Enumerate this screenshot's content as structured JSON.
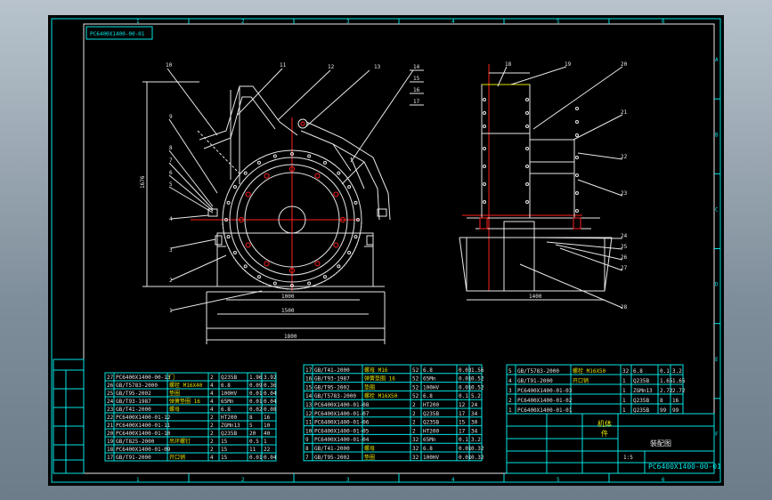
{
  "drawing": {
    "code_top": "PC6400X1400-00-01",
    "code_bottom": "PC6400X1400-00-01",
    "title_text": "装配图",
    "scale": "1:5",
    "border_numbers": [
      "1",
      "2",
      "3",
      "4",
      "5",
      "6"
    ],
    "border_letters": [
      "A",
      "B",
      "C",
      "D",
      "E",
      "F"
    ]
  },
  "front_view": {
    "balloons": [
      "10",
      "11",
      "12",
      "13",
      "14",
      "15",
      "16",
      "17",
      "9",
      "8",
      "7",
      "6",
      "5",
      "4",
      "3",
      "2",
      "1"
    ],
    "dims": [
      "1000",
      "1500",
      "1800",
      "1676"
    ]
  },
  "side_view": {
    "balloons": [
      "18",
      "19",
      "20",
      "21",
      "22",
      "23",
      "24",
      "25",
      "26",
      "27",
      "28"
    ],
    "dims": [
      "1400"
    ]
  },
  "bom_left": [
    {
      "no": "27",
      "code": "PC6400X1400-00-13",
      "name": "门",
      "qty": "2",
      "mat": "Q235B",
      "w": "1.96",
      "tw": "3.92"
    },
    {
      "no": "26",
      "code": "GB/T5783-2000",
      "name": "螺栓 M16X40",
      "qty": "4",
      "mat": "6.8",
      "w": "0.09",
      "tw": "0.36"
    },
    {
      "no": "25",
      "code": "GB/T95-2002",
      "name": "垫圈",
      "qty": "4",
      "mat": "100HV",
      "w": "0.01",
      "tw": "0.04"
    },
    {
      "no": "24",
      "code": "GB/T93-1987",
      "name": "弹簧垫圈 16",
      "qty": "4",
      "mat": "65Mn",
      "w": "0.01",
      "tw": "0.04"
    },
    {
      "no": "23",
      "code": "GB/T41-2000",
      "name": "螺母",
      "qty": "4",
      "mat": "6.8",
      "w": "0.02",
      "tw": "0.08"
    },
    {
      "no": "22",
      "code": "PC6400X1400-01-12",
      "name": "",
      "qty": "2",
      "mat": "HT200",
      "w": "8",
      "tw": "16"
    },
    {
      "no": "21",
      "code": "PC6400X1400-01-11",
      "name": "",
      "qty": "2",
      "mat": "ZGMn13",
      "w": "5",
      "tw": "10"
    },
    {
      "no": "20",
      "code": "PC6400X1400-01-10",
      "name": "",
      "qty": "2",
      "mat": "Q235B",
      "w": "20",
      "tw": "40"
    },
    {
      "no": "19",
      "code": "GB/T825-2000",
      "name": "吊环螺钉",
      "qty": "2",
      "mat": "15",
      "w": "0.5",
      "tw": "1"
    },
    {
      "no": "18",
      "code": "PC6400X1400-01-09",
      "name": "",
      "qty": "2",
      "mat": "15",
      "w": "11",
      "tw": "22"
    },
    {
      "no": "17",
      "code": "GB/T91-2000",
      "name": "开口销",
      "qty": "4",
      "mat": "15",
      "w": "0.01",
      "tw": "0.04"
    }
  ],
  "bom_mid": [
    {
      "no": "17",
      "code": "GB/T41-2000",
      "name": "螺母 M16",
      "qty": "52",
      "mat": "6.8",
      "w": "0.03",
      "tw": "1.56"
    },
    {
      "no": "16",
      "code": "GB/T93-1987",
      "name": "弹簧垫圈 16",
      "qty": "52",
      "mat": "65Mn",
      "w": "0.01",
      "tw": "0.52"
    },
    {
      "no": "15",
      "code": "GB/T95-2002",
      "name": "垫圈",
      "qty": "52",
      "mat": "100HV",
      "w": "0.01",
      "tw": "0.52"
    },
    {
      "no": "14",
      "code": "GB/T5783-2000",
      "name": "螺栓 M16X50",
      "qty": "52",
      "mat": "6.8",
      "w": "0.1",
      "tw": "5.2"
    },
    {
      "no": "13",
      "code": "PC6400X1400-01-08",
      "name": "",
      "qty": "2",
      "mat": "HT200",
      "w": "12",
      "tw": "24"
    },
    {
      "no": "12",
      "code": "PC6400X1400-01-07",
      "name": "",
      "qty": "2",
      "mat": "Q235B",
      "w": "17",
      "tw": "34"
    },
    {
      "no": "11",
      "code": "PC6400X1400-01-06",
      "name": "",
      "qty": "2",
      "mat": "Q235B",
      "w": "15",
      "tw": "30"
    },
    {
      "no": "10",
      "code": "PC6400X1400-01-05",
      "name": "",
      "qty": "2",
      "mat": "HT200",
      "w": "17",
      "tw": "34"
    },
    {
      "no": "9",
      "code": "PC6400X1400-01-04",
      "name": "",
      "qty": "32",
      "mat": "65Mn",
      "w": "0.1",
      "tw": "3.2"
    },
    {
      "no": "8",
      "code": "GB/T41-2000",
      "name": "螺母",
      "qty": "32",
      "mat": "6.8",
      "w": "0.01",
      "tw": "0.32"
    },
    {
      "no": "7",
      "code": "GB/T95-2002",
      "name": "垫圈",
      "qty": "32",
      "mat": "100HV",
      "w": "0.01",
      "tw": "0.32"
    }
  ],
  "bom_right": [
    {
      "no": "5",
      "code": "GB/T5783-2000",
      "name": "螺栓 M16X50",
      "qty": "32",
      "mat": "6.8",
      "w": "0.1",
      "tw": "3.2"
    },
    {
      "no": "4",
      "code": "GB/T91-2000",
      "name": "开口销",
      "qty": "1",
      "mat": "Q235B",
      "w": "1.65",
      "tw": "1.65"
    },
    {
      "no": "3",
      "code": "PC6400X1400-01-03",
      "name": "",
      "qty": "1",
      "mat": "ZGMn13",
      "w": "2.72",
      "tw": "2.72"
    },
    {
      "no": "2",
      "code": "PC6400X1400-01-02",
      "name": "",
      "qty": "1",
      "mat": "Q235B",
      "w": "8",
      "tw": "16"
    },
    {
      "no": "1",
      "code": "PC6400X1400-01-01",
      "name": "",
      "qty": "1",
      "mat": "Q235B",
      "w": "99",
      "tw": "99"
    }
  ],
  "title_block": {
    "part_name": "装配图",
    "drawing_no": "PC6400X1400-00-01",
    "label_left": "机体",
    "label_left2": "件"
  }
}
